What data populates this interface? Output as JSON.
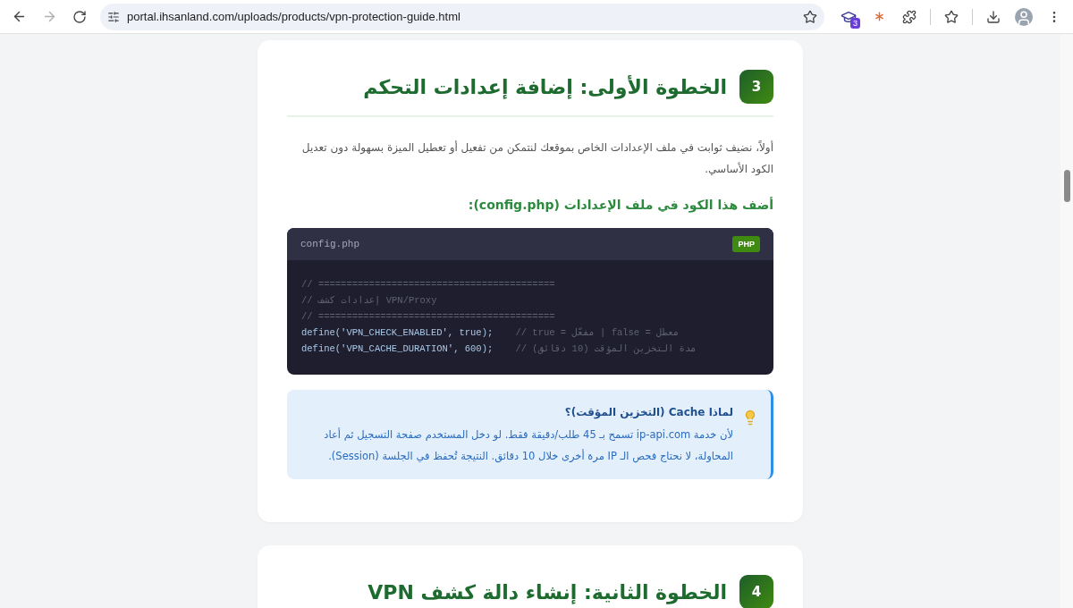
{
  "browser": {
    "url": "portal.ihsanland.com/uploads/products/vpn-protection-guide.html",
    "forward_disabled": true,
    "extension_badge": "3"
  },
  "steps": [
    {
      "number": "3",
      "title": "الخطوة الأولى: إضافة إعدادات التحكم",
      "blocks": [
        {
          "kind": "paragraph",
          "text": "أولاً، نضيف ثوابت في ملف الإعدادات الخاص بموقعك لنتمكن من تفعيل أو تعطيل الميزة بسهولة دون تعديل الكود الأساسي."
        },
        {
          "kind": "subheading",
          "text": "أضف هذا الكود في ملف الإعدادات (config.php):"
        },
        {
          "kind": "code",
          "filename": "config.php",
          "language": "PHP",
          "lines": [
            [
              {
                "kind": "comment",
                "text": "// =========================================="
              }
            ],
            [
              {
                "kind": "comment",
                "text": "// إعدادات كشف VPN/Proxy"
              }
            ],
            [
              {
                "kind": "comment",
                "text": "// =========================================="
              }
            ],
            {
              "code": "define('VPN_CHECK_ENABLED', true);",
              "comment": "// true = مفعّل | false = معطل"
            },
            {
              "code": "define('VPN_CACHE_DURATION', 600);",
              "comment": "// مدة التخزين المؤقت (10 دقائق)"
            }
          ]
        },
        {
          "kind": "note",
          "title": "لماذا Cache (التخزين المؤقت)؟",
          "text": "لأن خدمة ip-api.com تسمح بـ 45 طلب/دقيقة فقط. لو دخل المستخدم صفحة التسجيل ثم أعاد المحاولة، لا نحتاج فحص الـ IP مرة أخرى خلال 10 دقائق. النتيجة تُحفظ في الجلسة (Session)."
        }
      ]
    },
    {
      "number": "4",
      "title": "الخطوة الثانية: إنشاء دالة كشف VPN"
    }
  ]
}
